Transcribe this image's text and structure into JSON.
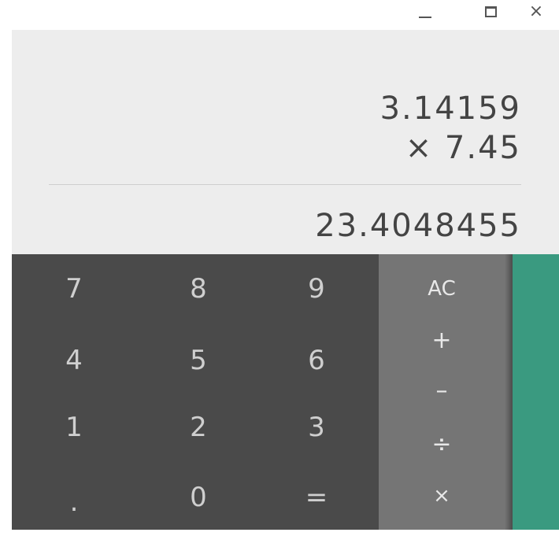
{
  "window": {
    "minimize_label": "",
    "maximize_label": "",
    "close_label": "×"
  },
  "display": {
    "expression_line1": "3.14159",
    "expression_line2": "× 7.45",
    "result": "23.4048455"
  },
  "keypad": {
    "digits": [
      "7",
      "8",
      "9",
      "4",
      "5",
      "6",
      "1",
      "2",
      "3",
      ".",
      "0",
      "="
    ]
  },
  "operators": {
    "clear": "AC",
    "add": "+",
    "subtract": "–",
    "divide": "÷",
    "multiply": "×"
  },
  "colors": {
    "display_bg": "#ededed",
    "keypad_bg": "#4a4a4a",
    "operators_bg": "#757575",
    "advanced_panel": "#3a9a80"
  }
}
